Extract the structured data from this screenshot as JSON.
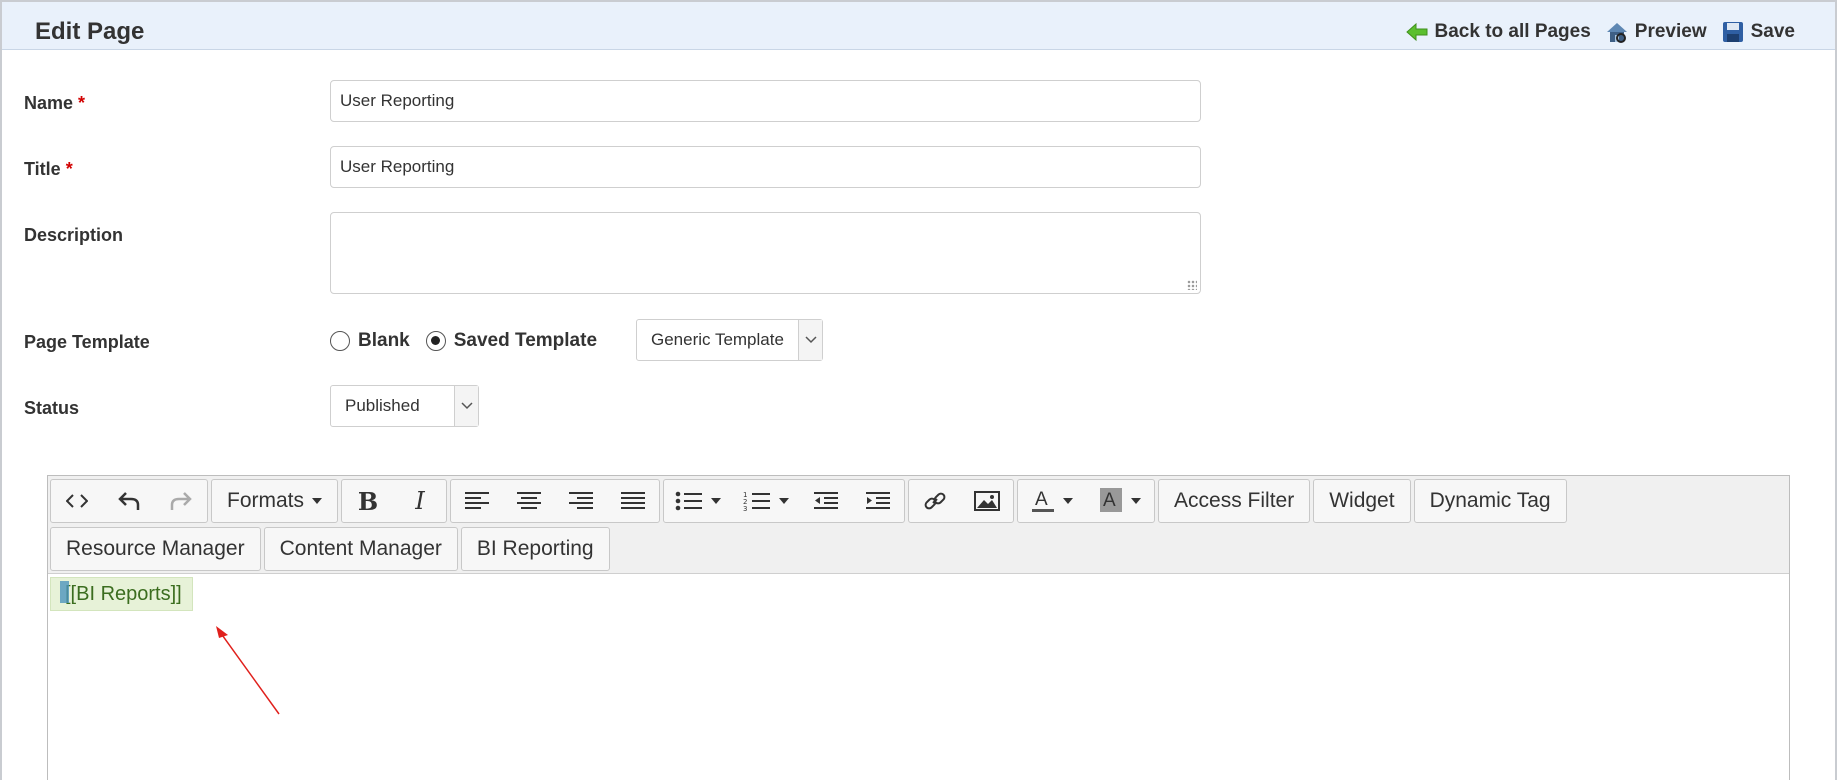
{
  "header": {
    "title": "Edit Page",
    "back_label": "Back to all Pages",
    "preview_label": "Preview",
    "save_label": "Save"
  },
  "form": {
    "name": {
      "label": "Name",
      "required_mark": "*",
      "value": "User Reporting"
    },
    "title": {
      "label": "Title",
      "required_mark": "*",
      "value": "User Reporting"
    },
    "description": {
      "label": "Description",
      "value": ""
    },
    "page_template": {
      "label": "Page Template",
      "options": [
        "Blank",
        "Saved Template"
      ],
      "selected": "Saved Template",
      "template_select": "Generic Template"
    },
    "status": {
      "label": "Status",
      "value": "Published"
    }
  },
  "editor": {
    "toolbar": {
      "formats_label": "Formats",
      "text_buttons_row1": [
        "Access Filter",
        "Widget",
        "Dynamic Tag"
      ],
      "text_buttons_row2": [
        "Resource Manager",
        "Content Manager",
        "BI Reporting"
      ]
    },
    "content_token": "[[BI Reports]]"
  },
  "colors": {
    "header_bg": "#e9f1fb",
    "required": "#d20000",
    "token_bg": "#e7f2d8",
    "token_text": "#3b6d1f",
    "annotation_arrow": "#e0201c"
  }
}
